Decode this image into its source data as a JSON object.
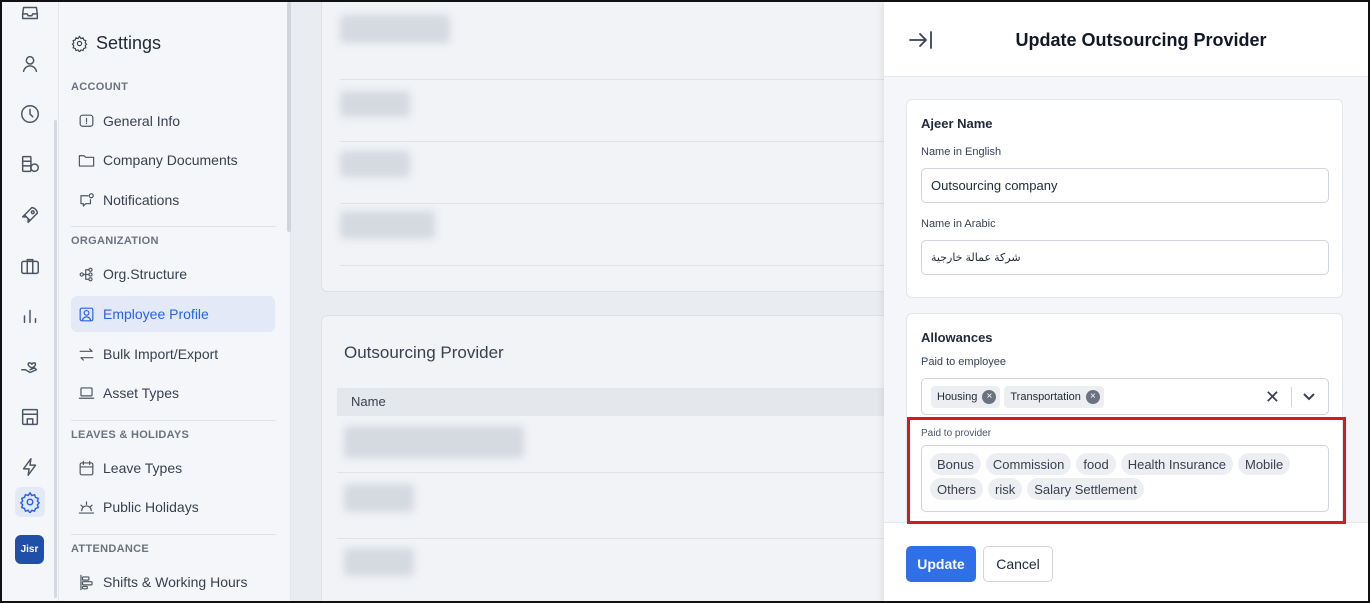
{
  "sidebar": {
    "title": "Settings",
    "sections": [
      {
        "label": "ACCOUNT",
        "items": [
          "General Info",
          "Company Documents",
          "Notifications"
        ]
      },
      {
        "label": "ORGANIZATION",
        "items": [
          "Org.Structure",
          "Employee Profile",
          "Bulk Import/Export",
          "Asset Types"
        ]
      },
      {
        "label": "LEAVES & HOLIDAYS",
        "items": [
          "Leave Types",
          "Public Holidays"
        ]
      },
      {
        "label": "ATTENDANCE",
        "items": [
          "Shifts & Working Hours"
        ]
      }
    ],
    "active_item": "Employee Profile"
  },
  "rail": {
    "logo_text": "Jisr"
  },
  "main": {
    "section_title": "Outsourcing Provider",
    "table_header": "Name"
  },
  "drawer": {
    "title": "Update Outsourcing Provider",
    "ajeer": {
      "heading": "Ajeer Name",
      "name_en_label": "Name in English",
      "name_en_value": "Outsourcing company",
      "name_ar_label": "Name in Arabic",
      "name_ar_value": "شركة عمالة خارجية"
    },
    "allowances": {
      "heading": "Allowances",
      "paid_employee_label": "Paid to employee",
      "paid_employee_chips": [
        "Housing",
        "Transportation"
      ],
      "paid_provider_label": "Paid to provider",
      "paid_provider_tags": [
        "Bonus",
        "Commission",
        "food",
        "Health Insurance",
        "Mobile",
        "Others",
        "risk",
        "Salary Settlement"
      ]
    },
    "buttons": {
      "update": "Update",
      "cancel": "Cancel"
    }
  },
  "colors": {
    "accent": "#2f6fe8",
    "highlight": "#d71920",
    "active_bg": "#e3e9f7"
  }
}
